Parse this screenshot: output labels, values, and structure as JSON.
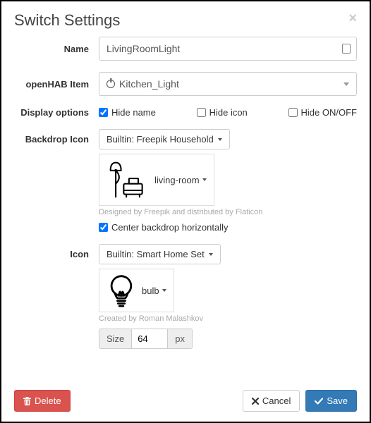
{
  "modal": {
    "title": "Switch Settings"
  },
  "labels": {
    "name": "Name",
    "item": "openHAB Item",
    "displayOptions": "Display options",
    "backdropIcon": "Backdrop Icon",
    "icon": "Icon",
    "size": "Size",
    "px": "px"
  },
  "fields": {
    "name": "LivingRoomLight",
    "item": "Kitchen_Light",
    "backdropSet": "Builtin: Freepik Household",
    "backdropIcon": "living-room",
    "backdropCredit": "Designed by Freepik and distributed by Flaticon",
    "iconSet": "Builtin: Smart Home Set",
    "iconName": "bulb",
    "iconCredit": "Created by Roman Malashkov",
    "iconSize": "64"
  },
  "checkboxes": {
    "hideName": {
      "label": "Hide name",
      "checked": true
    },
    "hideIcon": {
      "label": "Hide icon",
      "checked": false
    },
    "hideOnOff": {
      "label": "Hide ON/OFF",
      "checked": false
    },
    "centerBackdrop": {
      "label": "Center backdrop horizontally",
      "checked": true
    }
  },
  "buttons": {
    "delete": "Delete",
    "cancel": "Cancel",
    "save": "Save"
  }
}
